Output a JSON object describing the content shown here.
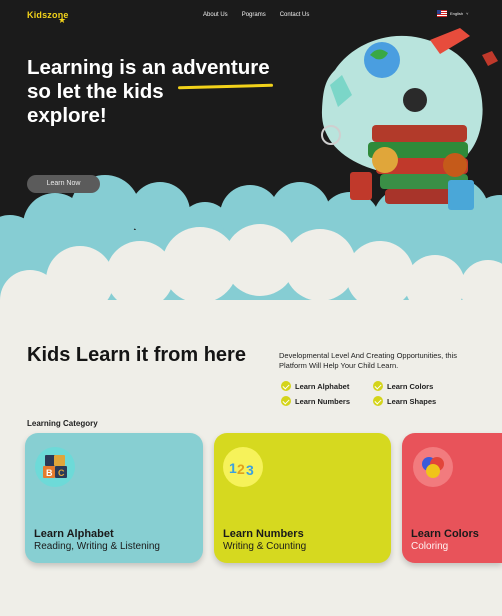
{
  "brand": {
    "name": "Kidszone"
  },
  "nav": {
    "links": [
      "About Us",
      "Pograms",
      "Contact Us"
    ],
    "language": "English"
  },
  "hero": {
    "title_lines": [
      "Learning is an adventure",
      "so let the kids",
      "explore!"
    ],
    "cta_label": "Learn Now"
  },
  "intro": {
    "heading": "Kids Learn it from here",
    "description": "Developmental Level And Creating Opportunities, this Platform Will Help Your Child Learn.",
    "features": [
      "Learn Alphabet",
      "Learn Colors",
      "Learn Numbers",
      "Learn Shapes"
    ]
  },
  "category": {
    "label": "Learning Category",
    "cards": [
      {
        "title": "Learn Alphabet",
        "subtitle": "Reading, Writing & Listening",
        "color": "#87cfd2",
        "icon": "alphabet-blocks-icon"
      },
      {
        "title": "Learn Numbers",
        "subtitle": "Writing & Counting",
        "color": "#d6d91f",
        "icon": "numbers-123-icon"
      },
      {
        "title": "Learn Colors",
        "subtitle": "Coloring",
        "color": "#e8535a",
        "icon": "color-balls-icon"
      }
    ]
  },
  "colors": {
    "accent": "#f2d21a",
    "hero_bg": "#1b1b1b",
    "cloud": "#86cdd3",
    "page_bg": "#efeee8"
  }
}
